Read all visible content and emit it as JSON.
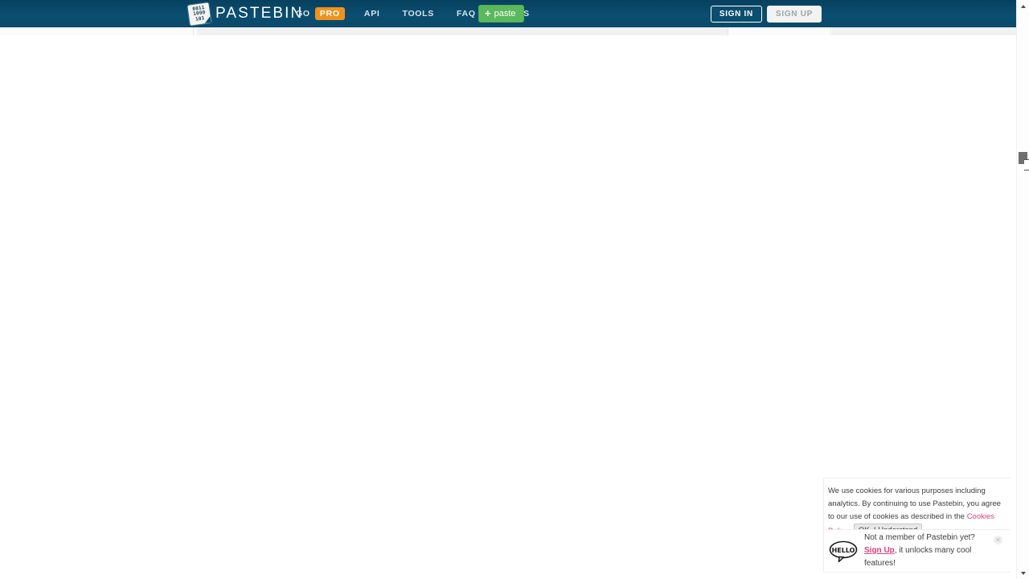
{
  "header": {
    "logo": {
      "icon": "pastebin-logo-icon",
      "bits_line1": "0011",
      "bits_line2": "1000",
      "bits_line3": "101",
      "wordmark": "PASTEBIN"
    },
    "nav": [
      {
        "key": "go-pro",
        "label": "GO",
        "badge": "PRO"
      },
      {
        "key": "api",
        "label": "API"
      },
      {
        "key": "tools",
        "label": "TOOLS"
      },
      {
        "key": "faq",
        "label": "FAQ"
      },
      {
        "key": "deals",
        "label": "DEALS"
      }
    ],
    "paste_button": {
      "icon": "plus-icon",
      "label": "paste"
    },
    "sign_in": "SIGN IN",
    "sign_up": "SIGN UP",
    "background_color": "#0a4a6b",
    "pro_badge_color": "#f0921e",
    "paste_button_color": "#5cb85c"
  },
  "cookie_notice": {
    "text_part1": "We use cookies for various purposes including analytics. By continuing to use Pastebin, you agree to our use of cookies as described in the ",
    "policy_link": "Cookies Policy",
    "text_part2": ".",
    "accept_button": "OK, I Understand",
    "link_color": "#d9427a"
  },
  "signup_toast": {
    "bubble_icon": "hello-speech-bubble-icon",
    "bubble_text": "HELLO",
    "line1": "Not a member of Pastebin yet?",
    "link": "Sign Up",
    "line2": ", it unlocks many cool features!",
    "close_icon": "close-icon",
    "close_glyph": "✕"
  },
  "scrollbar": {
    "up_arrow_icon": "scroll-up-arrow-icon",
    "down_arrow_icon": "scroll-down-arrow-icon",
    "thumb_name": "scrollbar-thumb"
  },
  "main": {
    "state": ""
  }
}
